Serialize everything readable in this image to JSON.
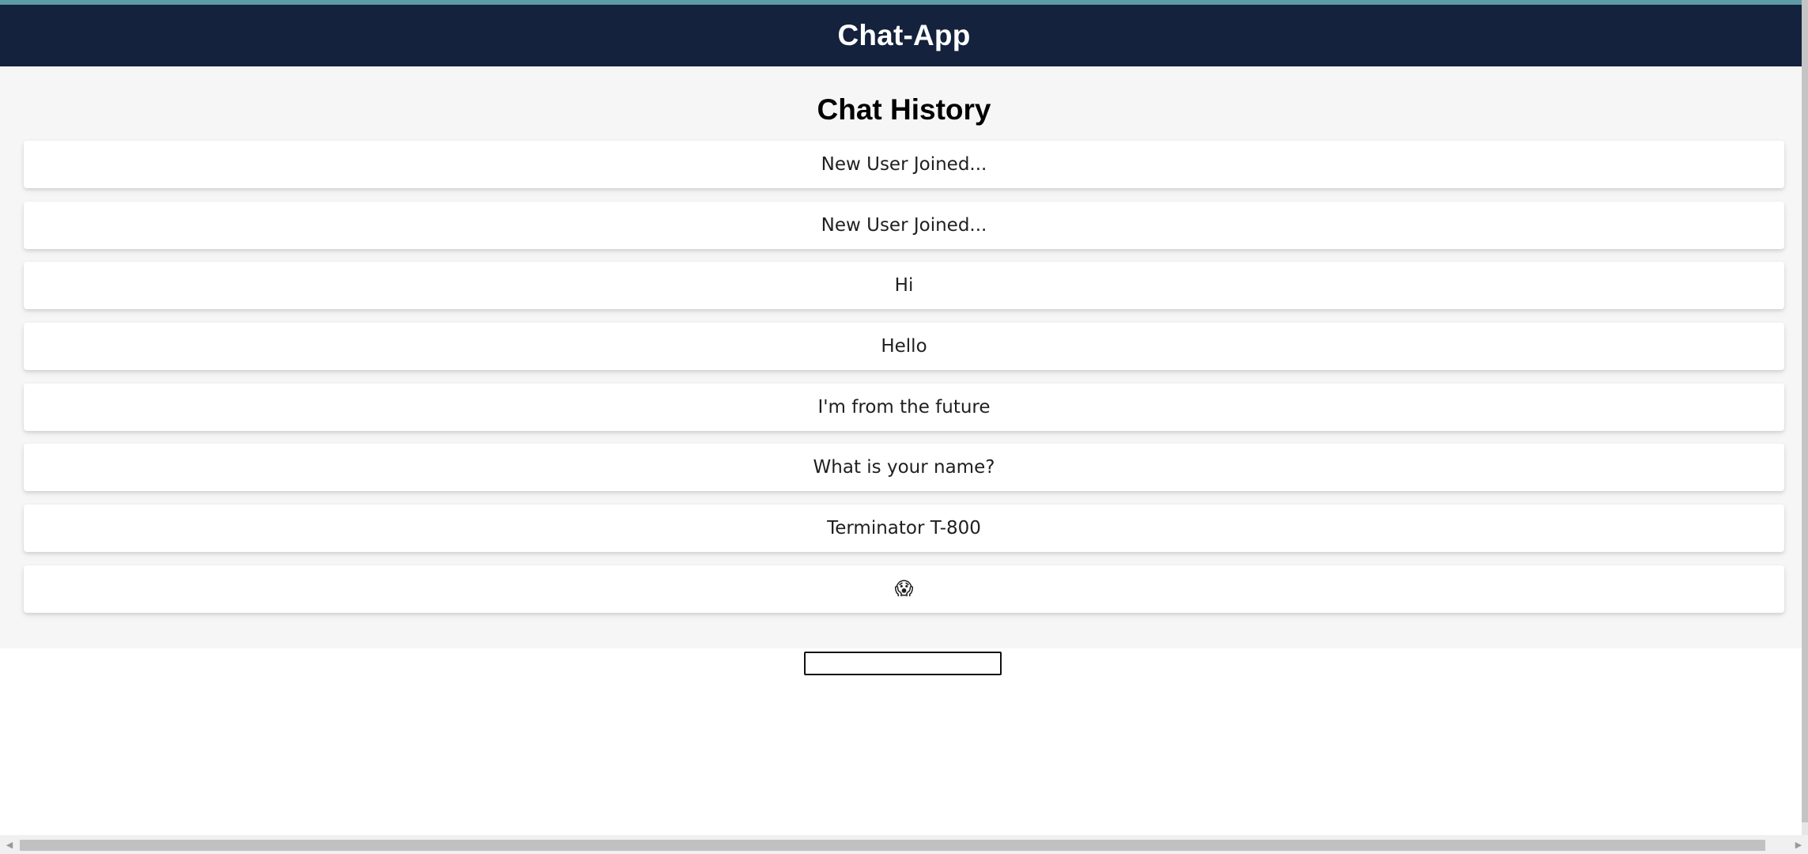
{
  "header": {
    "title": "Chat-App"
  },
  "history": {
    "heading": "Chat History",
    "messages": [
      "New User Joined...",
      "New User Joined...",
      "Hi",
      "Hello",
      "I'm from the future",
      "What is your name?",
      "Terminator T-800",
      "😱"
    ]
  },
  "input": {
    "value": "",
    "placeholder": ""
  },
  "icons": {
    "scroll_left": "chevron-left-icon",
    "scroll_right": "chevron-right-icon"
  },
  "colors": {
    "header_bg": "#15223d",
    "accent_stripe": "#5e9ba6",
    "history_bg": "#f6f6f6"
  }
}
